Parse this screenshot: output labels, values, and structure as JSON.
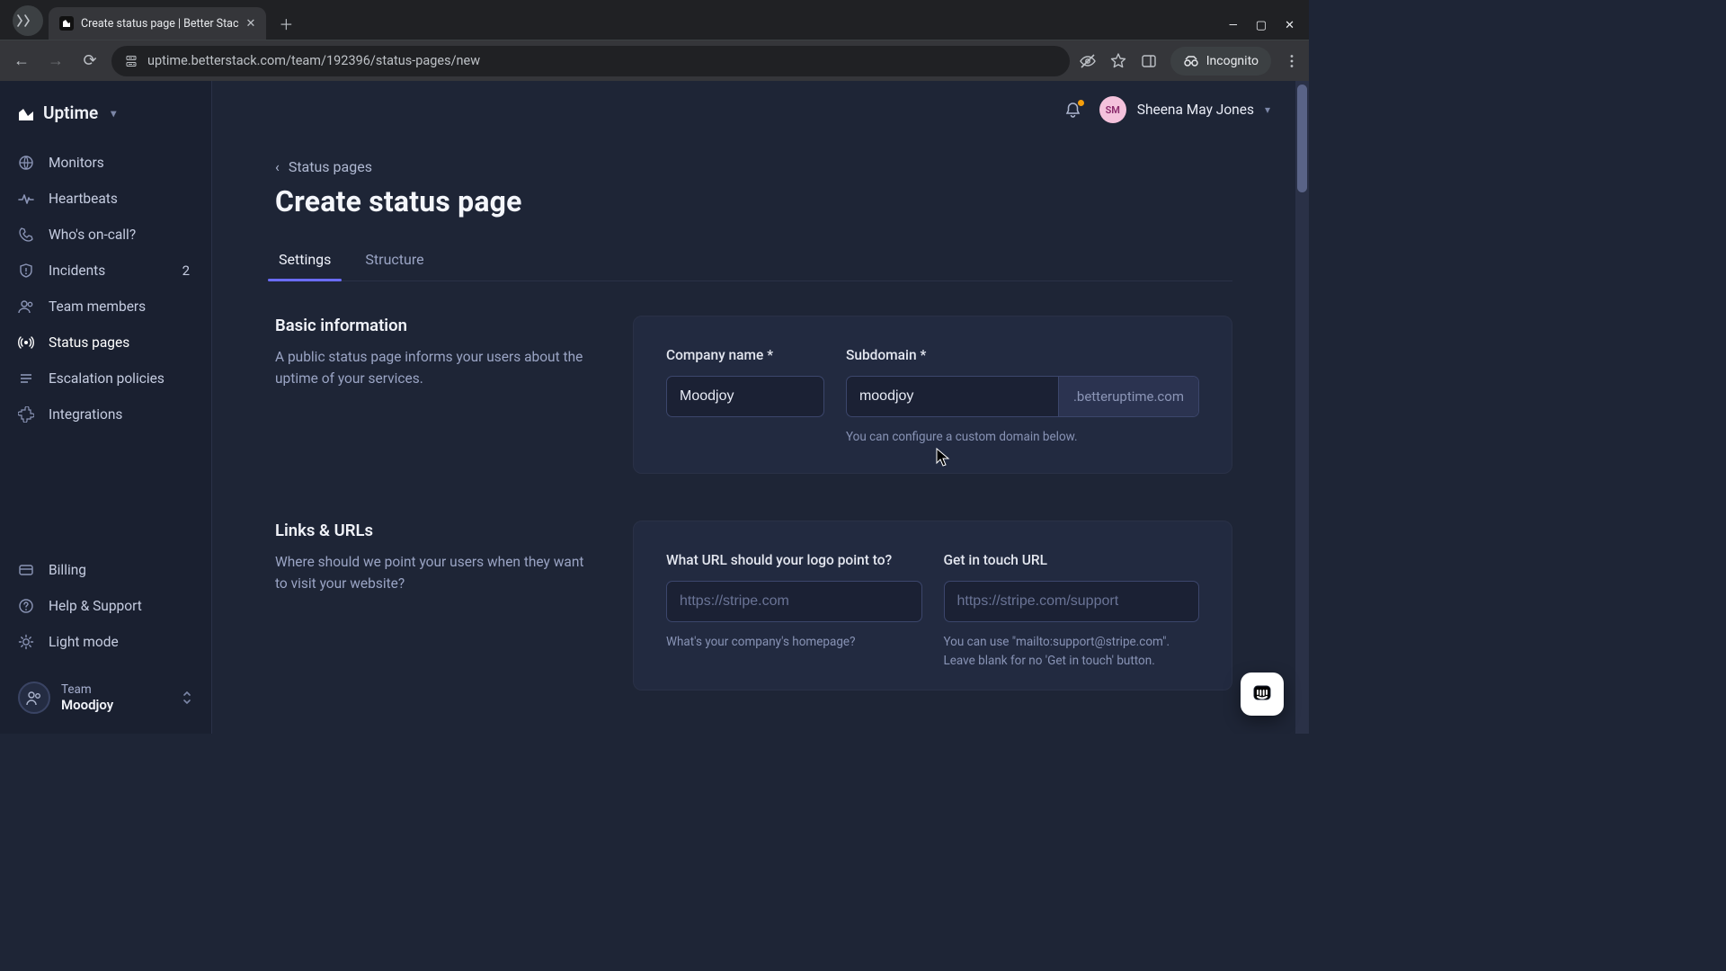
{
  "browser": {
    "tab_title": "Create status page | Better Stac",
    "url": "uptime.betterstack.com/team/192396/status-pages/new",
    "incognito_label": "Incognito"
  },
  "brand": {
    "name": "Uptime"
  },
  "sidebar": {
    "items": [
      {
        "label": "Monitors"
      },
      {
        "label": "Heartbeats"
      },
      {
        "label": "Who's on-call?"
      },
      {
        "label": "Incidents",
        "badge": "2"
      },
      {
        "label": "Team members"
      },
      {
        "label": "Status pages"
      },
      {
        "label": "Escalation policies"
      },
      {
        "label": "Integrations"
      }
    ],
    "bottom": [
      {
        "label": "Billing"
      },
      {
        "label": "Help & Support"
      },
      {
        "label": "Light mode"
      }
    ],
    "team": {
      "label": "Team",
      "name": "Moodjoy"
    }
  },
  "header": {
    "user_initials": "SM",
    "user_name": "Sheena May Jones"
  },
  "page": {
    "back_label": "Status pages",
    "title": "Create status page",
    "tabs": [
      {
        "label": "Settings",
        "active": true
      },
      {
        "label": "Structure",
        "active": false
      }
    ]
  },
  "sections": {
    "basic": {
      "heading": "Basic information",
      "desc": "A public status page informs your users about the uptime of your services.",
      "company_label": "Company name *",
      "company_value": "Moodjoy",
      "subdomain_label": "Subdomain *",
      "subdomain_value": "moodjoy",
      "subdomain_suffix": ".betteruptime.com",
      "subdomain_hint": "You can configure a custom domain below."
    },
    "links": {
      "heading": "Links & URLs",
      "desc": "Where should we point your users when they want to visit your website?",
      "logo_label": "What URL should your logo point to?",
      "logo_placeholder": "https://stripe.com",
      "logo_hint": "What's your company's homepage?",
      "touch_label": "Get in touch URL",
      "touch_placeholder": "https://stripe.com/support",
      "touch_hint": "You can use \"mailto:support@stripe.com\". Leave blank for no 'Get in touch' button."
    }
  }
}
